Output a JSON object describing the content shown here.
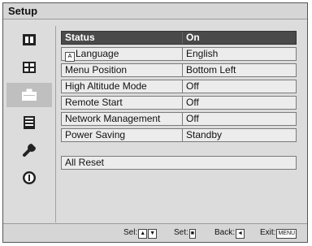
{
  "title": "Setup",
  "categories": [
    {
      "icon": "picture-icon"
    },
    {
      "icon": "screen-icon"
    },
    {
      "icon": "setup-icon"
    },
    {
      "icon": "menu-icon"
    },
    {
      "icon": "wrench-icon"
    },
    {
      "icon": "information-icon"
    }
  ],
  "settings": [
    {
      "label": "Status",
      "value": "On"
    },
    {
      "label": "Language",
      "value": "English"
    },
    {
      "label": "Menu Position",
      "value": "Bottom Left"
    },
    {
      "label": "High Altitude Mode",
      "value": "Off"
    },
    {
      "label": "Remote Start",
      "value": "Off"
    },
    {
      "label": "Network Management",
      "value": "Off"
    },
    {
      "label": "Power Saving",
      "value": "Standby"
    }
  ],
  "reset_label": "All Reset",
  "status_bar": {
    "sel": "Sel:",
    "set": "Set:",
    "back": "Back:",
    "exit": "Exit:",
    "menu_key": "MENU"
  }
}
